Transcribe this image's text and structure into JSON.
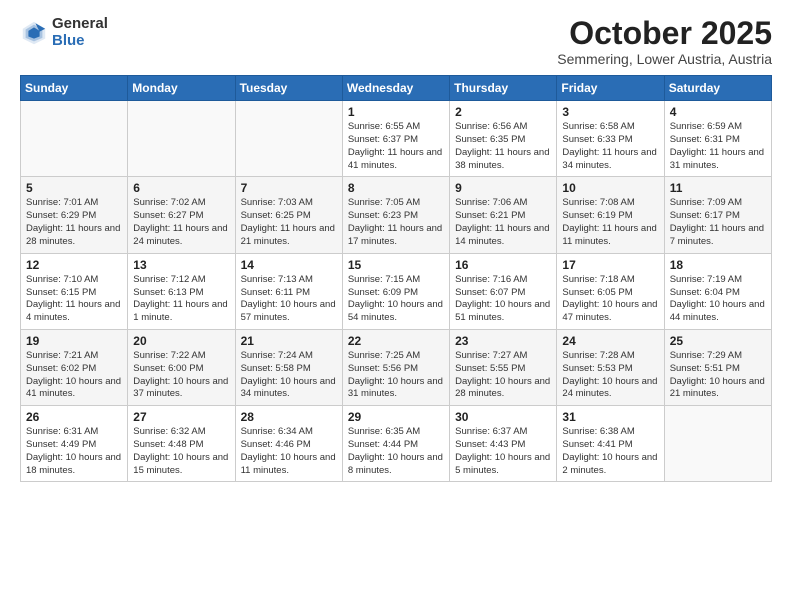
{
  "header": {
    "logo_general": "General",
    "logo_blue": "Blue",
    "month_title": "October 2025",
    "subtitle": "Semmering, Lower Austria, Austria"
  },
  "days_of_week": [
    "Sunday",
    "Monday",
    "Tuesday",
    "Wednesday",
    "Thursday",
    "Friday",
    "Saturday"
  ],
  "weeks": [
    [
      {
        "day": "",
        "info": ""
      },
      {
        "day": "",
        "info": ""
      },
      {
        "day": "",
        "info": ""
      },
      {
        "day": "1",
        "info": "Sunrise: 6:55 AM\nSunset: 6:37 PM\nDaylight: 11 hours\nand 41 minutes."
      },
      {
        "day": "2",
        "info": "Sunrise: 6:56 AM\nSunset: 6:35 PM\nDaylight: 11 hours\nand 38 minutes."
      },
      {
        "day": "3",
        "info": "Sunrise: 6:58 AM\nSunset: 6:33 PM\nDaylight: 11 hours\nand 34 minutes."
      },
      {
        "day": "4",
        "info": "Sunrise: 6:59 AM\nSunset: 6:31 PM\nDaylight: 11 hours\nand 31 minutes."
      }
    ],
    [
      {
        "day": "5",
        "info": "Sunrise: 7:01 AM\nSunset: 6:29 PM\nDaylight: 11 hours\nand 28 minutes."
      },
      {
        "day": "6",
        "info": "Sunrise: 7:02 AM\nSunset: 6:27 PM\nDaylight: 11 hours\nand 24 minutes."
      },
      {
        "day": "7",
        "info": "Sunrise: 7:03 AM\nSunset: 6:25 PM\nDaylight: 11 hours\nand 21 minutes."
      },
      {
        "day": "8",
        "info": "Sunrise: 7:05 AM\nSunset: 6:23 PM\nDaylight: 11 hours\nand 17 minutes."
      },
      {
        "day": "9",
        "info": "Sunrise: 7:06 AM\nSunset: 6:21 PM\nDaylight: 11 hours\nand 14 minutes."
      },
      {
        "day": "10",
        "info": "Sunrise: 7:08 AM\nSunset: 6:19 PM\nDaylight: 11 hours\nand 11 minutes."
      },
      {
        "day": "11",
        "info": "Sunrise: 7:09 AM\nSunset: 6:17 PM\nDaylight: 11 hours\nand 7 minutes."
      }
    ],
    [
      {
        "day": "12",
        "info": "Sunrise: 7:10 AM\nSunset: 6:15 PM\nDaylight: 11 hours\nand 4 minutes."
      },
      {
        "day": "13",
        "info": "Sunrise: 7:12 AM\nSunset: 6:13 PM\nDaylight: 11 hours\nand 1 minute."
      },
      {
        "day": "14",
        "info": "Sunrise: 7:13 AM\nSunset: 6:11 PM\nDaylight: 10 hours\nand 57 minutes."
      },
      {
        "day": "15",
        "info": "Sunrise: 7:15 AM\nSunset: 6:09 PM\nDaylight: 10 hours\nand 54 minutes."
      },
      {
        "day": "16",
        "info": "Sunrise: 7:16 AM\nSunset: 6:07 PM\nDaylight: 10 hours\nand 51 minutes."
      },
      {
        "day": "17",
        "info": "Sunrise: 7:18 AM\nSunset: 6:05 PM\nDaylight: 10 hours\nand 47 minutes."
      },
      {
        "day": "18",
        "info": "Sunrise: 7:19 AM\nSunset: 6:04 PM\nDaylight: 10 hours\nand 44 minutes."
      }
    ],
    [
      {
        "day": "19",
        "info": "Sunrise: 7:21 AM\nSunset: 6:02 PM\nDaylight: 10 hours\nand 41 minutes."
      },
      {
        "day": "20",
        "info": "Sunrise: 7:22 AM\nSunset: 6:00 PM\nDaylight: 10 hours\nand 37 minutes."
      },
      {
        "day": "21",
        "info": "Sunrise: 7:24 AM\nSunset: 5:58 PM\nDaylight: 10 hours\nand 34 minutes."
      },
      {
        "day": "22",
        "info": "Sunrise: 7:25 AM\nSunset: 5:56 PM\nDaylight: 10 hours\nand 31 minutes."
      },
      {
        "day": "23",
        "info": "Sunrise: 7:27 AM\nSunset: 5:55 PM\nDaylight: 10 hours\nand 28 minutes."
      },
      {
        "day": "24",
        "info": "Sunrise: 7:28 AM\nSunset: 5:53 PM\nDaylight: 10 hours\nand 24 minutes."
      },
      {
        "day": "25",
        "info": "Sunrise: 7:29 AM\nSunset: 5:51 PM\nDaylight: 10 hours\nand 21 minutes."
      }
    ],
    [
      {
        "day": "26",
        "info": "Sunrise: 6:31 AM\nSunset: 4:49 PM\nDaylight: 10 hours\nand 18 minutes."
      },
      {
        "day": "27",
        "info": "Sunrise: 6:32 AM\nSunset: 4:48 PM\nDaylight: 10 hours\nand 15 minutes."
      },
      {
        "day": "28",
        "info": "Sunrise: 6:34 AM\nSunset: 4:46 PM\nDaylight: 10 hours\nand 11 minutes."
      },
      {
        "day": "29",
        "info": "Sunrise: 6:35 AM\nSunset: 4:44 PM\nDaylight: 10 hours\nand 8 minutes."
      },
      {
        "day": "30",
        "info": "Sunrise: 6:37 AM\nSunset: 4:43 PM\nDaylight: 10 hours\nand 5 minutes."
      },
      {
        "day": "31",
        "info": "Sunrise: 6:38 AM\nSunset: 4:41 PM\nDaylight: 10 hours\nand 2 minutes."
      },
      {
        "day": "",
        "info": ""
      }
    ]
  ]
}
